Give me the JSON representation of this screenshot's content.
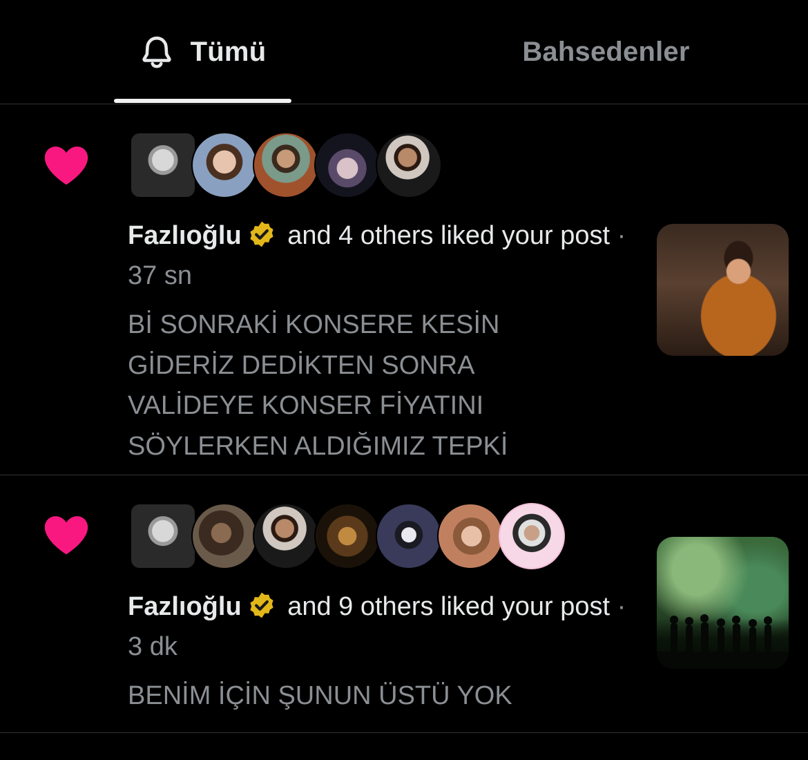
{
  "tabs": {
    "all_label": "Tümü",
    "mentions_label": "Bahsedenler",
    "active": "all",
    "icon": "bell-icon"
  },
  "colors": {
    "background": "#000000",
    "heart": "#f91880",
    "verified": "#e2b719",
    "primary_text": "#e7e9ea",
    "secondary_text": "#8b8f93",
    "divider": "#2f3336"
  },
  "notifications": [
    {
      "type": "like",
      "icon": "heart-icon",
      "avatar_count": 5,
      "actor_name": "Fazlıoğlu",
      "verified_icon": "verified-badge-icon",
      "action_text": "and 4 others liked your post",
      "separator": "·",
      "time": "37 sn",
      "post_text": "Bİ SONRAKİ KONSERE KESİN\nGİDERİZ DEDİKTEN SONRA\nVALİDEYE KONSER FİYATINI\nSÖYLERKEN ALDIĞIMIZ TEPKİ"
    },
    {
      "type": "like",
      "icon": "heart-icon",
      "avatar_count": 7,
      "actor_name": "Fazlıoğlu",
      "verified_icon": "verified-badge-icon",
      "action_text": "and 9 others liked your post",
      "separator": "·",
      "time": "3 dk",
      "post_text": "BENİM İÇİN ŞUNUN ÜSTÜ YOK"
    }
  ]
}
